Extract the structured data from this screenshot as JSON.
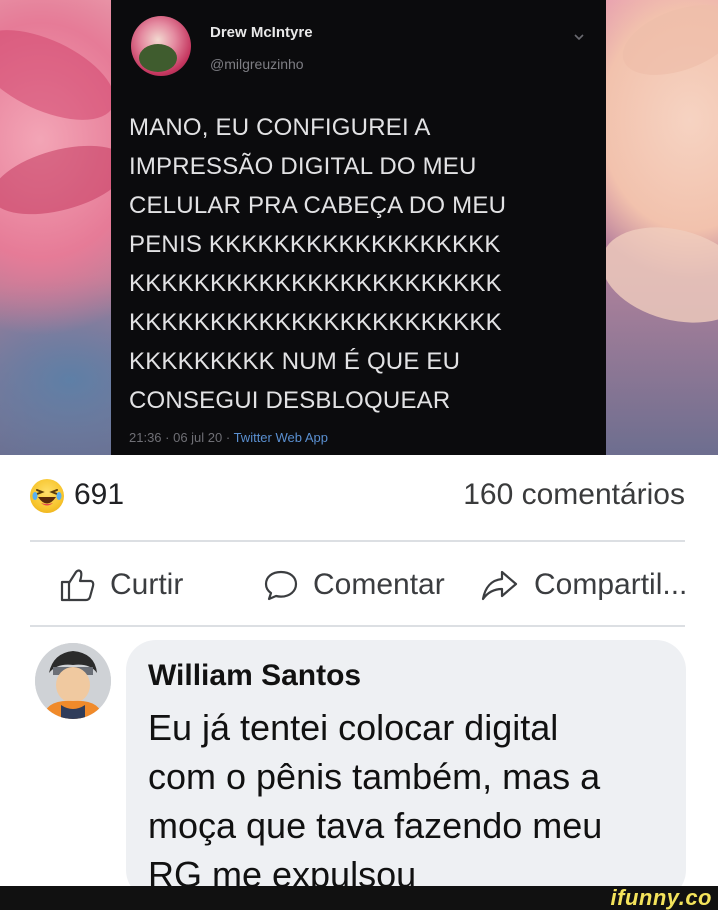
{
  "tweet": {
    "name": "Drew McIntyre",
    "handle": "@milgreuzinho",
    "text": "MANO, EU CONFIGUREI A\nIMPRESSÃO DIGITAL DO MEU\nCELULAR PRA CABEÇA DO MEU\nPENIS KKKKKKKKKKKKKKKKKK\nKKKKKKKKKKKKKKKKKKKKKKK\nKKKKKKKKKKKKKKKKKKKKKKK\nKKKKKKKKK NUM É QUE EU\nCONSEGUI DESBLOQUEAR",
    "timestamp": "21:36 · 06 jul 20 ·",
    "source": "Twitter Web App"
  },
  "post": {
    "reaction_icon": "laughing-emoji-icon",
    "reaction_count": "691",
    "comments_count": "160 comentários"
  },
  "actions": {
    "like": "Curtir",
    "comment": "Comentar",
    "share": "Compartil..."
  },
  "comment": {
    "author": "William Santos",
    "text": "Eu já tentei colocar digital\ncom o pênis também, mas a\nmoça que tava fazendo meu\nRG me expulsou"
  },
  "watermark": "ifunny.co",
  "colors": {
    "tweet_bg": "#0b0b0d",
    "bubble_bg": "#eef0f3",
    "watermark": "#f3e35b"
  }
}
